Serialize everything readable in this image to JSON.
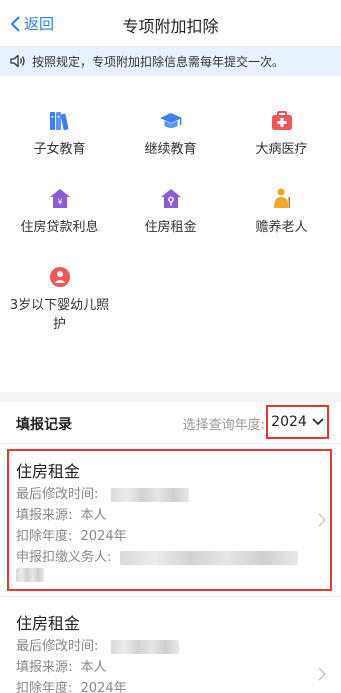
{
  "nav": {
    "back_label": "返回",
    "title": "专项附加扣除"
  },
  "notice": {
    "text": "按照规定，专项附加扣除信息需每年提交一次。"
  },
  "categories": [
    {
      "label": "子女教育",
      "icon": "books-icon"
    },
    {
      "label": "继续教育",
      "icon": "graduation-cap-icon"
    },
    {
      "label": "大病医疗",
      "icon": "medical-kit-icon"
    },
    {
      "label": "住房贷款利息",
      "icon": "house-loan-icon"
    },
    {
      "label": "住房租金",
      "icon": "house-key-icon"
    },
    {
      "label": "赡养老人",
      "icon": "elderly-icon"
    },
    {
      "label": "3岁以下婴幼儿照护",
      "icon": "infant-icon"
    }
  ],
  "records": {
    "heading": "填报记录",
    "year_label": "选择查询年度:",
    "year_value": "2024",
    "items": [
      {
        "title": "住房租金",
        "modified_label": "最后修改时间:",
        "source_label": "填报来源:",
        "source_value": "本人",
        "year_label": "扣除年度:",
        "year_value": "2024年",
        "agent_label": "申报扣缴义务人:"
      },
      {
        "title": "住房租金",
        "modified_label": "最后修改时间:",
        "source_label": "填报来源:",
        "source_value": "本人",
        "year_label": "扣除年度:",
        "year_value": "2024年"
      }
    ]
  },
  "colors": {
    "accent": "#2f7cf6",
    "icon_blue": "#3d7ef5",
    "icon_purple": "#8e5bd8",
    "icon_red": "#f25757",
    "highlight": "#e53935"
  }
}
